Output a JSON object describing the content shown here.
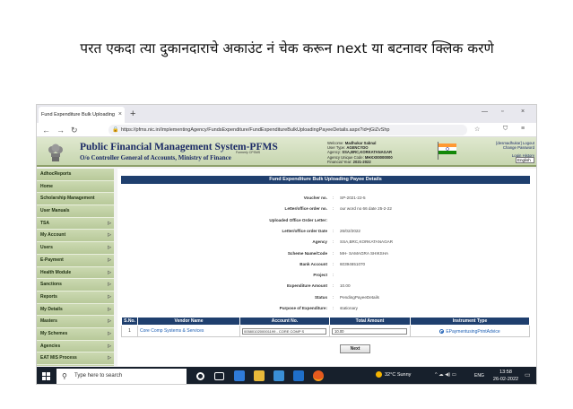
{
  "caption": "परत एकदा त्या दुकानदाराचे अकाउंट नं चेक करून next या बटनावर क्लिक करणे",
  "browser": {
    "tab_title": "Fund Expenditure Bulk Uploading",
    "tab_close": "×",
    "new_tab": "+",
    "url": "https://pfms.nic.in/ImplementingAgency/FundsExpenditure/FundExpenditureBulkUploadingPayeeDetails.aspx?id=jGiZvShp",
    "minimize": "—",
    "maximize": "▫",
    "close": "×"
  },
  "header": {
    "title": "Public Financial Management System-PFMS",
    "subtitle": "O/o Controller General of Accounts, Ministry of Finance",
    "tag": "Formerly CPSMS",
    "welcome_label": "Welcome:",
    "welcome_value": "Madhukar Sabnal",
    "user_type_label": "User Type:",
    "user_type_value": "AGENCYDO",
    "agency_label": "Agency:",
    "agency_value": "SSA,BRC,KORKATANAGAR",
    "agency_code_label": "Agency Unique Code:",
    "agency_code_value": "MHXX00000000",
    "fy_label": "Financial Year:",
    "fy_value": "2021-2022",
    "logout": "[desmadhukar] Logout",
    "change_password": "Change Password",
    "login_history": "Login History",
    "language": "English"
  },
  "sidebar": {
    "items": [
      {
        "label": "AdhocReports",
        "arrow": ""
      },
      {
        "label": "Home",
        "arrow": ""
      },
      {
        "label": "Scholarship Management",
        "arrow": ""
      },
      {
        "label": "User Manuals",
        "arrow": ""
      },
      {
        "label": "TSA",
        "arrow": "▷"
      },
      {
        "label": "My Account",
        "arrow": "▷"
      },
      {
        "label": "Users",
        "arrow": "▷"
      },
      {
        "label": "E-Payment",
        "arrow": "▷"
      },
      {
        "label": "Health Module",
        "arrow": "▷"
      },
      {
        "label": "Sanctions",
        "arrow": "▷"
      },
      {
        "label": "Reports",
        "arrow": "▷"
      },
      {
        "label": "My Details",
        "arrow": "▷"
      },
      {
        "label": "Masters",
        "arrow": "▷"
      },
      {
        "label": "My Schemes",
        "arrow": "▷"
      },
      {
        "label": "Agencies",
        "arrow": "▷"
      },
      {
        "label": "EAT MIS Process",
        "arrow": "▷"
      }
    ]
  },
  "panel": {
    "title": "Fund Expenditure Bulk Uploading Payee Details",
    "fields": [
      {
        "label": "Voucher no.",
        "colon": ":",
        "value": "SP-2021-22-5"
      },
      {
        "label": "Letter/office order no.",
        "colon": ":",
        "value": "our word no 66 date 25-2-22"
      },
      {
        "label": "Uploaded Office Order Letter:",
        "colon": "",
        "value": ""
      },
      {
        "label": "Letter/office order Date",
        "colon": ":",
        "value": "26/02/2022"
      },
      {
        "label": "Agency",
        "colon": ":",
        "value": "SSA,BRC,KORKATANAGAR"
      },
      {
        "label": "Scheme Name/Code",
        "colon": ":",
        "value": "MH- SAMAGRA SHIKSHA"
      },
      {
        "label": "Bank Account",
        "colon": ":",
        "value": "60394651070"
      },
      {
        "label": "Project",
        "colon": ":",
        "value": ""
      },
      {
        "label": "Expenditure Amount",
        "colon": ":",
        "value": "10.00"
      },
      {
        "label": "Status",
        "colon": ":",
        "value": "PendingPayeeDetails"
      },
      {
        "label": "Purpose of Expenditure:",
        "colon": ":",
        "value": "stationary"
      }
    ],
    "table": {
      "headers": [
        "S.No.",
        "Vendor Name",
        "Account No.",
        "Total Amount",
        "Instrument Type"
      ],
      "row": {
        "sno": "1",
        "vendor": "Core Comp Systems & Services",
        "account": "0058010200001199 - CORE COMP S",
        "amount": "10.00",
        "instrument": "EPaymentusingPrintAdvice"
      }
    },
    "next_label": "Next"
  },
  "taskbar": {
    "search_placeholder": "Type here to search",
    "weather": "32°C  Sunny",
    "tray": "^ ☁ ◀) ▭",
    "lang": "ENG",
    "time": "13:58",
    "date": "26-02-2022",
    "notification": "▭"
  }
}
